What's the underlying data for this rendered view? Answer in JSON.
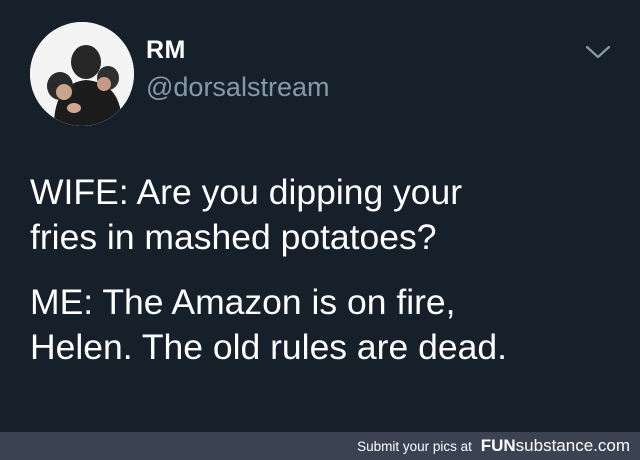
{
  "tweet": {
    "display_name": "RM",
    "handle": "@dorsalstream",
    "menu_icon": "chevron-down-icon",
    "avatar": "profile-photo",
    "lines": [
      "WIFE: Are you dipping your",
      "fries in mashed potatoes?",
      "ME: The Amazon is on fire,",
      "Helen. The old rules are dead."
    ]
  },
  "footer": {
    "submit_text": "Submit your pics at",
    "brand_bold": "FUN",
    "brand_rest": "substance.com"
  },
  "colors": {
    "background": "#15202b",
    "footer_bg": "#3b4353",
    "text": "#ffffff",
    "muted": "#8899a6"
  }
}
